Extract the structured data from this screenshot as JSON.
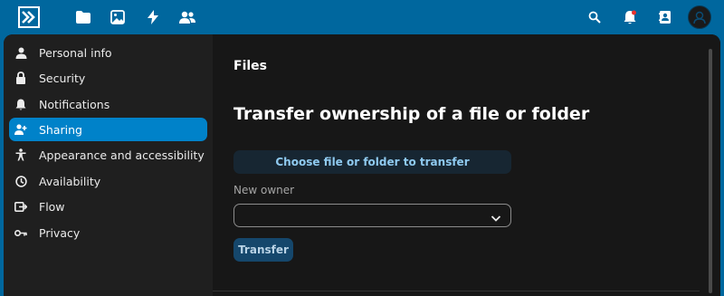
{
  "colors": {
    "header": "#00679e",
    "nav_bg": "#1f1f1f",
    "content_bg": "#171717",
    "active": "#0082c9",
    "choose_button": "#172632",
    "transfer_button": "#15476c"
  },
  "header": {
    "logo": "nextcloud-logo-icon",
    "apps": [
      "files-icon",
      "photos-icon",
      "activity-icon",
      "contacts-icon"
    ],
    "right": [
      "search-icon",
      "notifications-icon",
      "contacts-menu-icon",
      "avatar"
    ]
  },
  "sidebar": {
    "items": [
      {
        "label": "Personal info",
        "icon": "person-icon"
      },
      {
        "label": "Security",
        "icon": "lock-icon"
      },
      {
        "label": "Notifications",
        "icon": "bell-icon"
      },
      {
        "label": "Sharing",
        "icon": "share-person-icon",
        "active": true
      },
      {
        "label": "Appearance and accessibility",
        "icon": "accessibility-icon"
      },
      {
        "label": "Availability",
        "icon": "clock-icon"
      },
      {
        "label": "Flow",
        "icon": "flow-icon"
      },
      {
        "label": "Privacy",
        "icon": "key-icon"
      }
    ]
  },
  "main": {
    "section_title": "Files",
    "title": "Transfer ownership of a file or folder",
    "choose_button": "Choose file or folder to transfer",
    "new_owner_label": "New owner",
    "new_owner_value": "",
    "transfer_button": "Transfer"
  }
}
